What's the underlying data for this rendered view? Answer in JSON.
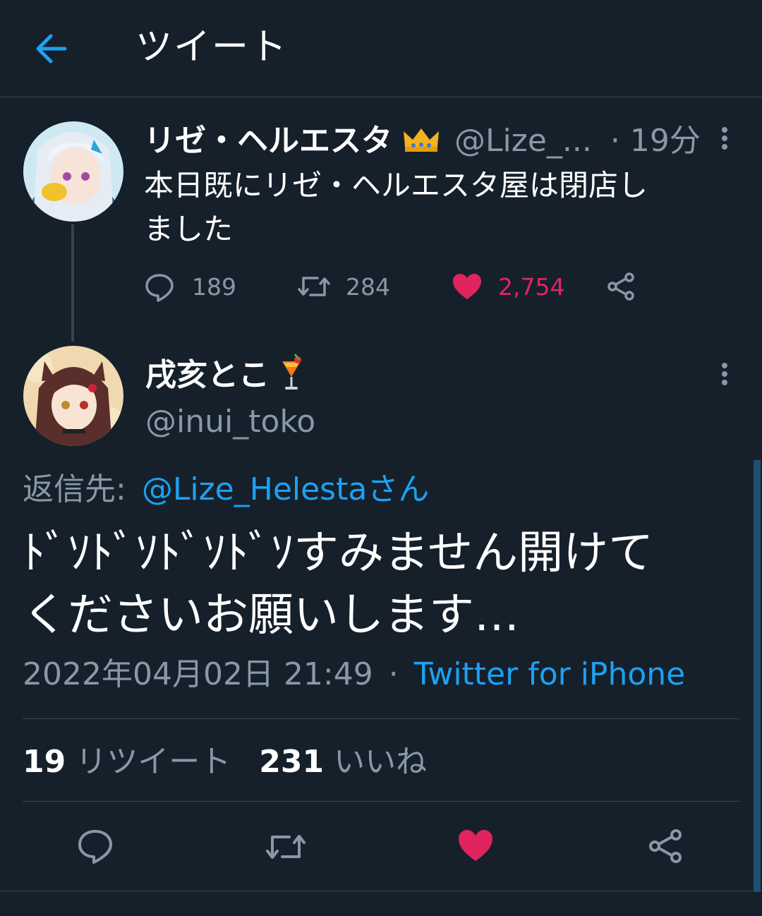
{
  "header": {
    "title": "ツイート"
  },
  "parent_tweet": {
    "display_name": "リゼ・ヘルエスタ",
    "handle": "@Lize_...",
    "time": "· 19分",
    "text_line1": "本日既にリゼ・ヘルエスタ屋は閉店し",
    "text_line2": "ました",
    "replies": "189",
    "retweets": "284",
    "likes": "2,754"
  },
  "main_tweet": {
    "display_name": "戌亥とこ",
    "handle": "@inui_toko",
    "reply_to_label": "返信先:",
    "reply_to_handle": "@Lize_Helestaさん",
    "text_line1": "ﾄﾞｿﾄﾞｿﾄﾞｿﾄﾞｿすみません開けて",
    "text_line2": "くださいお願いします…",
    "timestamp": "2022年04月02日 21:49",
    "separator": "·",
    "source": "Twitter for iPhone",
    "retweet_count": "19",
    "retweet_label": "リツイート",
    "like_count": "231",
    "like_label": "いいね"
  },
  "colors": {
    "background": "#15202b",
    "accent": "#1da1f2",
    "like": "#e0245e",
    "muted": "#8899a6",
    "divider": "#38444d"
  },
  "icons": [
    "back-arrow-icon",
    "crown-icon",
    "more-icon",
    "reply-icon",
    "retweet-icon",
    "heart-icon",
    "share-icon",
    "cocktail-icon"
  ]
}
